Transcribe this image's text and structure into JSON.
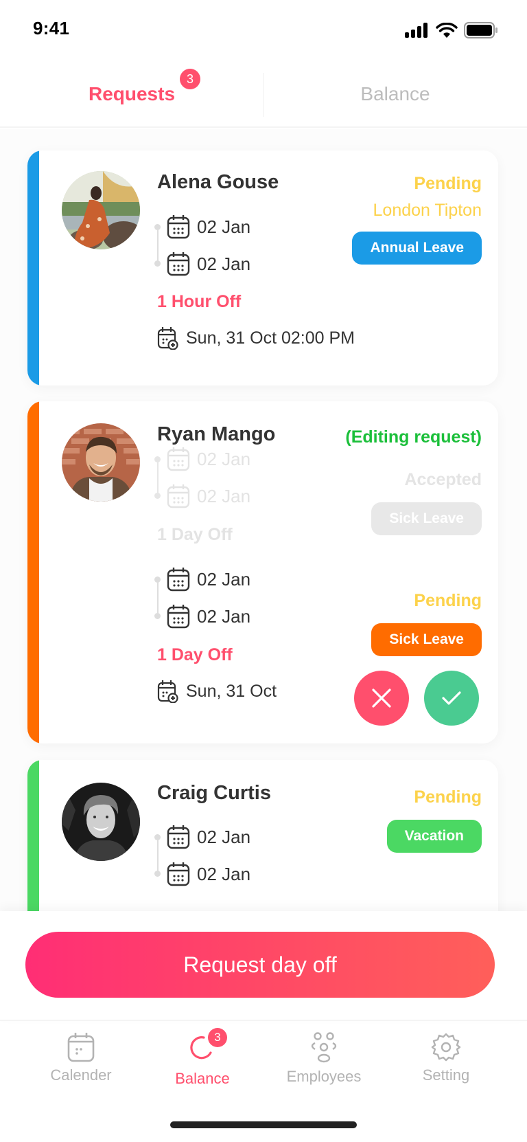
{
  "status_bar": {
    "time": "9:41"
  },
  "top_tabs": {
    "requests": {
      "label": "Requests",
      "badge": "3",
      "active": true
    },
    "balance": {
      "label": "Balance",
      "active": false
    }
  },
  "colors": {
    "primary": "#ff4f6d",
    "pending": "#fcd24b",
    "editing": "#1bbf3a",
    "annual_leave": "#1b9be6",
    "sick_leave": "#ff6c00",
    "vacation": "#4bd863",
    "reject": "#ff4f6d",
    "approve": "#4acb91"
  },
  "requests": [
    {
      "name": "Alena Gouse",
      "status": "Pending",
      "approver": "London Tipton",
      "leave_type": "Annual Leave",
      "from": "02 Jan",
      "to": "02 Jan",
      "duration": "1 Hour Off",
      "requested_on": "Sun, 31 Oct 02:00 PM"
    },
    {
      "name": "Ryan Mango",
      "edit_label": "(Editing request)",
      "previous": {
        "status": "Accepted",
        "leave_type": "Sick Leave",
        "from": "02 Jan",
        "to": "02 Jan",
        "duration": "1 Day Off"
      },
      "current": {
        "status": "Pending",
        "leave_type": "Sick Leave",
        "from": "02 Jan",
        "to": "02 Jan",
        "duration": "1 Day Off",
        "requested_on": "Sun, 31 Oct"
      },
      "actions": {
        "reject": "reject",
        "approve": "approve"
      }
    },
    {
      "name": "Craig Curtis",
      "status": "Pending",
      "leave_type": "Vacation",
      "from": "02 Jan",
      "to": "02 Jan"
    }
  ],
  "cta": {
    "label": "Request day off"
  },
  "bottom_nav": [
    {
      "label": "Calender",
      "icon": "calendar-icon",
      "active": false
    },
    {
      "label": "Balance",
      "icon": "balance-icon",
      "active": true,
      "badge": "3"
    },
    {
      "label": "Employees",
      "icon": "employees-icon",
      "active": false
    },
    {
      "label": "Setting",
      "icon": "gear-icon",
      "active": false
    }
  ]
}
